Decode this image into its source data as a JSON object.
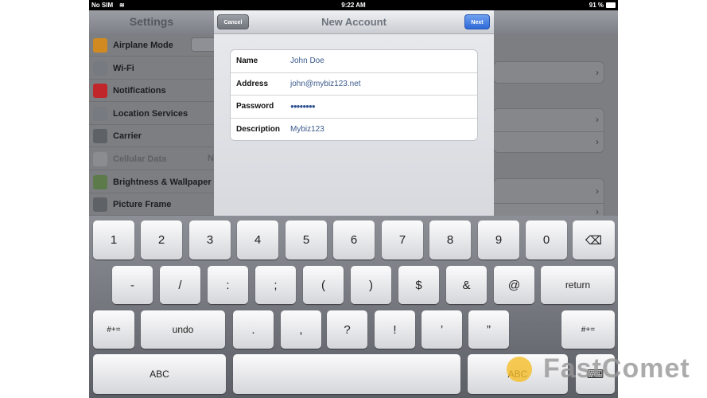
{
  "status_bar": {
    "carrier": "No SIM",
    "time": "9:22 AM",
    "battery": "91 %"
  },
  "settings": {
    "title": "Settings",
    "items": [
      {
        "label": "Airplane Mode",
        "icon": "airplane-icon",
        "color": "#d08a20"
      },
      {
        "label": "Wi-Fi",
        "icon": "wifi-icon",
        "color": "#777a80"
      },
      {
        "label": "Notifications",
        "icon": "notifications-icon",
        "color": "#c0262a"
      },
      {
        "label": "Location Services",
        "icon": "location-icon",
        "color": "#777a80"
      },
      {
        "label": "Carrier",
        "icon": "phone-icon",
        "color": "#5e6166"
      },
      {
        "label": "Cellular Data",
        "icon": "antenna-icon",
        "color": "#8a8c90",
        "disabled": true
      },
      {
        "label": "Brightness & Wallpaper",
        "icon": "flower-icon",
        "color": "#5c7a4a"
      },
      {
        "label": "Picture Frame",
        "icon": "picture-frame-icon",
        "color": "#5e6166"
      }
    ],
    "cellular_value": "N"
  },
  "modal": {
    "title": "New Account",
    "cancel_label": "Cancel",
    "next_label": "Next",
    "fields": [
      {
        "label": "Name",
        "value": "John Doe"
      },
      {
        "label": "Address",
        "value": "john@mybiz123.net"
      },
      {
        "label": "Password",
        "value": "●●●●●●●●"
      },
      {
        "label": "Description",
        "value": "Mybiz123"
      }
    ]
  },
  "keyboard": {
    "rows": [
      [
        "1",
        "2",
        "3",
        "4",
        "5",
        "6",
        "7",
        "8",
        "9",
        "0",
        "⌫"
      ],
      [
        "-",
        "/",
        ":",
        ";",
        "(",
        ")",
        "$",
        "&",
        "@",
        "return"
      ],
      [
        "#+=",
        "undo",
        ".",
        ",",
        "?",
        "!",
        "’",
        "”",
        "#+="
      ],
      [
        "ABC",
        "",
        "ABC",
        "⌨"
      ]
    ]
  },
  "watermark": {
    "text": "FastComet"
  }
}
